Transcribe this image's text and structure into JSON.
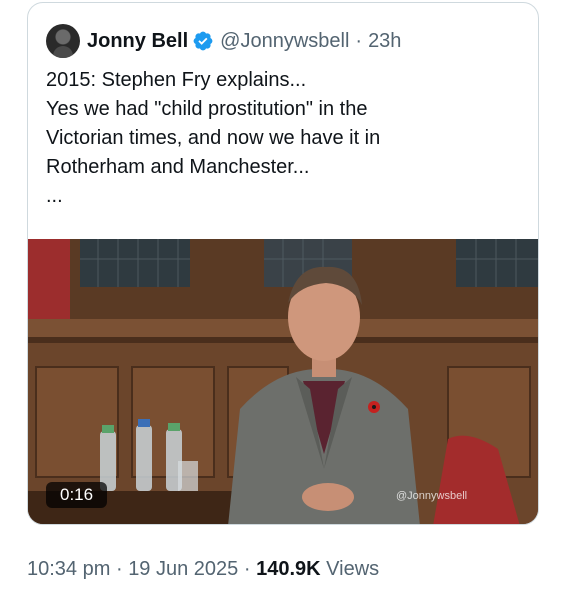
{
  "tweet": {
    "author_name": "Jonny Bell",
    "handle": "@Jonnywsbell",
    "separator": "·",
    "time_ago": "23h",
    "text_lines": [
      "2015: Stephen Fry explains...",
      "Yes we had \"child prostitution\" in the",
      "Victorian times, and now we have it in",
      "Rotherham and Manchester...",
      "..."
    ],
    "video": {
      "duration": "0:16",
      "watermark": "@Jonnywsbell"
    }
  },
  "meta": {
    "time": "10:34 pm",
    "separator1": "·",
    "date": "19 Jun 2025",
    "separator2": "·",
    "views_count": "140.9K",
    "views_label": "Views"
  },
  "colors": {
    "verified_badge": "#1d9bf0",
    "text_primary": "#0f1419",
    "text_secondary": "#536471",
    "card_border": "#cfd9de"
  }
}
